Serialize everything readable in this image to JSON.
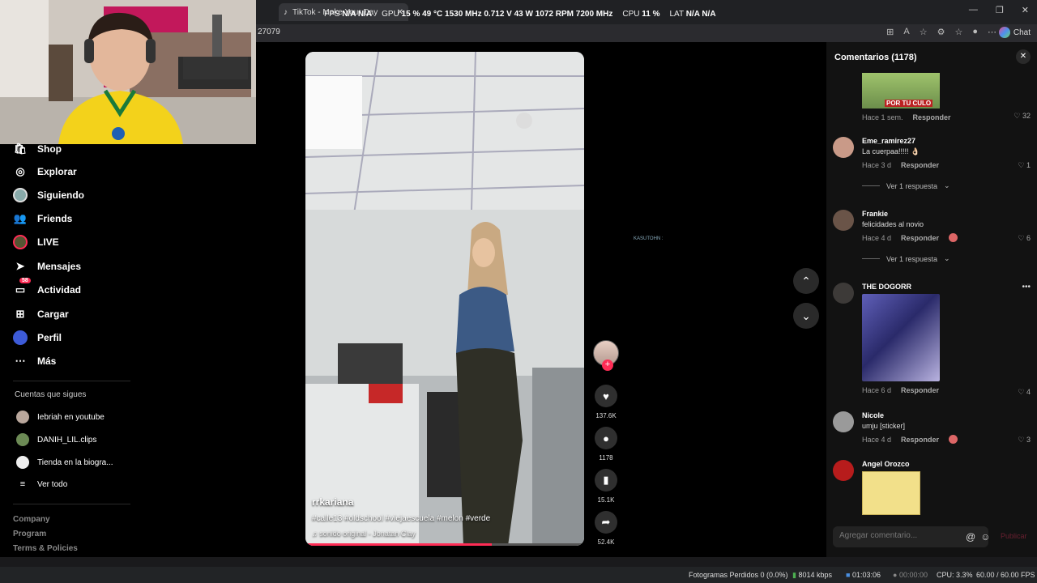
{
  "browser": {
    "tab_title": "TikTok - Make Your Day",
    "address": "27079",
    "chat_label": "Chat"
  },
  "overlay_stats": {
    "fps_label": "FPS",
    "fps_value": "N/A  N/A",
    "gpu_label": "GPU",
    "gpu_value": "15 %  49 °C  1530 MHz  0.712 V  43 W  1072 RPM  7200 MHz",
    "cpu_label": "CPU",
    "cpu_value": "11 %",
    "lat_label": "LAT",
    "lat_value": "N/A  N/A"
  },
  "sidebar": {
    "items": [
      {
        "label": "Shop",
        "icon": "shop-icon"
      },
      {
        "label": "Explorar",
        "icon": "compass-icon"
      },
      {
        "label": "Siguiendo",
        "icon": "following-avatar-icon"
      },
      {
        "label": "Friends",
        "icon": "friends-icon"
      },
      {
        "label": "LIVE",
        "icon": "live-icon"
      },
      {
        "label": "Mensajes",
        "icon": "send-icon"
      },
      {
        "label": "Actividad",
        "icon": "inbox-icon",
        "badge": "58"
      },
      {
        "label": "Cargar",
        "icon": "upload-icon"
      },
      {
        "label": "Perfil",
        "icon": "profile-icon"
      },
      {
        "label": "Más",
        "icon": "more-icon"
      }
    ],
    "following_title": "Cuentas que sigues",
    "following": [
      {
        "label": "Iebriah en youtube"
      },
      {
        "label": "DANIH_LIL.clips"
      },
      {
        "label": "Tienda en la biogra..."
      }
    ],
    "see_all": "Ver todo",
    "footer": [
      "Company",
      "Program",
      "Terms & Policies"
    ]
  },
  "video": {
    "username": "rrkariana",
    "hashtags": "#calle13 #oldschool #viejaescuela #melon #verde",
    "sound": "sonido original - Jonatan Clay",
    "progress": 0.67
  },
  "actions": {
    "likes": "137.6K",
    "comments": "1178",
    "saves": "15.1K",
    "shares": "52.4K"
  },
  "floating_tag": "KASUTOHN :",
  "comments_panel": {
    "title": "Comentarios (1178)",
    "input_placeholder": "Agregar comentario...",
    "publish": "Publicar",
    "first": {
      "image_text": "POR TU CULO",
      "time": "Hace 1 sem.",
      "reply": "Responder",
      "likes": "32"
    },
    "items": [
      {
        "name": "Eme_ramirez27",
        "text": "La cuerpaa!!!!! 👌🏻",
        "time": "Hace 3 d",
        "reply": "Responder",
        "likes": "1",
        "view_replies": "Ver 1 respuesta"
      },
      {
        "name": "Frankie",
        "text": "felicidades al novio",
        "time": "Hace 4 d",
        "reply": "Responder",
        "likes": "6",
        "view_replies": "Ver 1 respuesta"
      },
      {
        "name": "THE DOGORR",
        "time": "Hace 6 d",
        "reply": "Responder",
        "likes": "4",
        "more": "•••"
      },
      {
        "name": "Nicole",
        "text": "umju [sticker]",
        "time": "Hace 4 d",
        "reply": "Responder",
        "likes": "3"
      },
      {
        "name": "Angel Orozco"
      }
    ]
  },
  "obs": {
    "dropped": "Fotogramas Perdidos 0 (0.0%)",
    "bitrate": "8014 kbps",
    "rec_time": "01:03:06",
    "stream_time": "00:00:00",
    "cpu": "CPU: 3.3%",
    "fps": "60.00 / 60.00 FPS"
  }
}
